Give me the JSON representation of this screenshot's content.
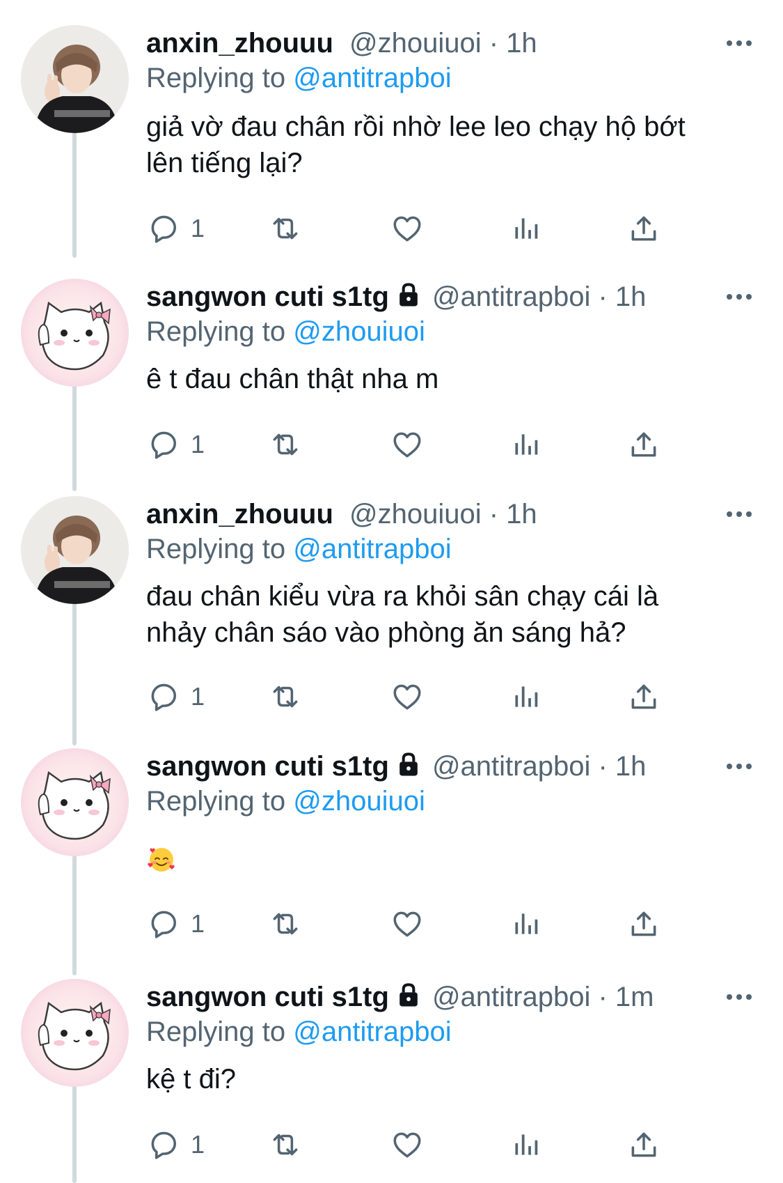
{
  "reply_prefix": "Replying to",
  "tweets": [
    {
      "display_name": "anxin_zhouuu",
      "handle": "@zhouiuoi",
      "time": "1h",
      "reply_to": "@antitrapboi",
      "text_lines": [
        "giả vờ đau chân rồi nhờ lee leo chạy hộ bớt",
        "lên tiếng lại?"
      ],
      "reply_count": "1",
      "avatar": "person-avatar",
      "locked": false
    },
    {
      "display_name": "sangwon cuti s1tg",
      "handle": "@antitrapboi",
      "time": "1h",
      "reply_to": "@zhouiuoi",
      "text_lines": [
        "ê t đau chân thật nha m"
      ],
      "reply_count": "1",
      "avatar": "cat-avatar",
      "locked": true
    },
    {
      "display_name": "anxin_zhouuu",
      "handle": "@zhouiuoi",
      "time": "1h",
      "reply_to": "@antitrapboi",
      "text_lines": [
        "đau chân kiểu vừa ra khỏi sân chạy cái là",
        "nhảy chân sáo vào phòng ăn sáng hả?"
      ],
      "reply_count": "1",
      "avatar": "person-avatar",
      "locked": false
    },
    {
      "display_name": "sangwon cuti s1tg",
      "handle": "@antitrapboi",
      "time": "1h",
      "reply_to": "@zhouiuoi",
      "text_lines": [],
      "emoji": "smiling-face-with-hearts",
      "reply_count": "1",
      "avatar": "cat-avatar",
      "locked": true
    },
    {
      "display_name": "sangwon cuti s1tg",
      "handle": "@antitrapboi",
      "time": "1m",
      "reply_to": "@antitrapboi",
      "text_lines": [
        "kệ t đi?"
      ],
      "reply_count": "1",
      "avatar": "cat-avatar",
      "locked": true
    }
  ],
  "colors": {
    "text": "#0f1419",
    "secondary": "#536471",
    "link": "#1d9bf0",
    "thread_line": "#cfd9de"
  }
}
